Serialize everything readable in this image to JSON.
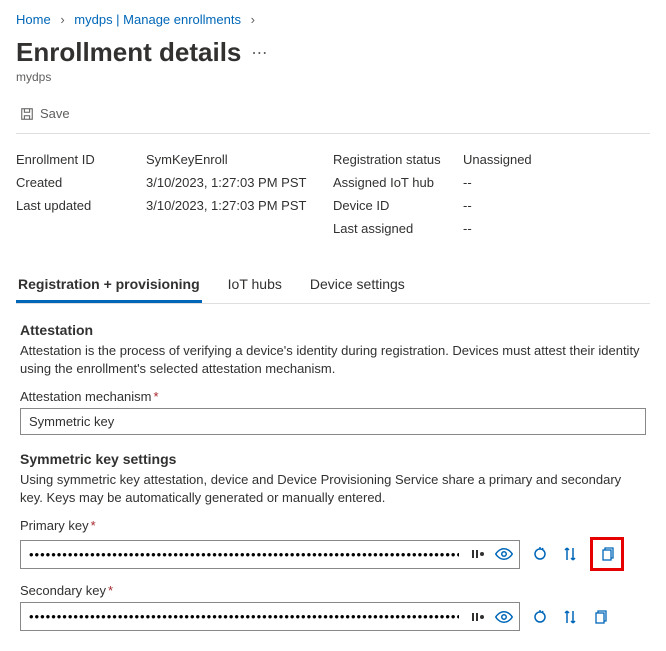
{
  "breadcrumb": {
    "home": "Home",
    "mid": "mydps | Manage enrollments"
  },
  "page": {
    "title": "Enrollment details",
    "subtitle": "mydps"
  },
  "toolbar": {
    "save": "Save"
  },
  "details": {
    "left": {
      "enrollment_id_label": "Enrollment ID",
      "enrollment_id_value": "SymKeyEnroll",
      "created_label": "Created",
      "created_value": "3/10/2023, 1:27:03 PM PST",
      "last_updated_label": "Last updated",
      "last_updated_value": "3/10/2023, 1:27:03 PM PST"
    },
    "right": {
      "reg_status_label": "Registration status",
      "reg_status_value": "Unassigned",
      "assigned_hub_label": "Assigned IoT hub",
      "assigned_hub_value": "--",
      "device_id_label": "Device ID",
      "device_id_value": "--",
      "last_assigned_label": "Last assigned",
      "last_assigned_value": "--"
    }
  },
  "tabs": {
    "t1": "Registration + provisioning",
    "t2": "IoT hubs",
    "t3": "Device settings"
  },
  "attestation": {
    "heading": "Attestation",
    "desc": "Attestation is the process of verifying a device's identity during registration. Devices must attest their identity using the enrollment's selected attestation mechanism.",
    "mechanism_label": "Attestation mechanism",
    "mechanism_value": "Symmetric key"
  },
  "symkey": {
    "heading": "Symmetric key settings",
    "desc": "Using symmetric key attestation, device and Device Provisioning Service share a primary and secondary key. Keys may be automatically generated or manually entered.",
    "primary_label": "Primary key",
    "primary_value": "••••••••••••••••••••••••••••••••••••••••••••••••••••••••••••••••••••••••••••••••••••",
    "secondary_label": "Secondary key",
    "secondary_value": "••••••••••••••••••••••••••••••••••••••••••••••••••••••••••••••••••••••••••••••••••••"
  }
}
